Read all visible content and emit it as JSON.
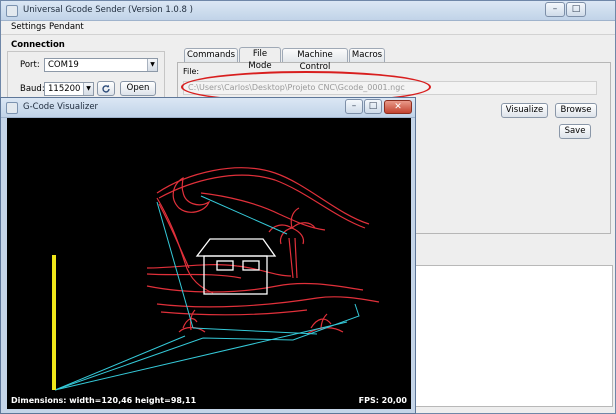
{
  "main_window": {
    "title": "Universal Gcode Sender (Version 1.0.8 )",
    "controls": {
      "minimize": "–",
      "maximize": "□"
    },
    "menu": [
      "Settings",
      "Pendant"
    ],
    "connection": {
      "title": "Connection",
      "port_label": "Port:",
      "port_value": "COM19",
      "baud_label": "Baud:",
      "baud_value": "115200",
      "open_label": "Open",
      "refresh_icon": "refresh-icon"
    },
    "tabs": [
      "Commands",
      "File Mode",
      "Machine Control",
      "Macros"
    ],
    "active_tab": "File Mode",
    "file_label": "File:",
    "file_path": "C:\\Users\\Carlos\\Desktop\\Projeto CNC\\Gcode_0001.ngc",
    "buttons": {
      "visualize": "Visualize",
      "browse": "Browse",
      "save": "Save"
    },
    "highlight_color": "#d81e1e"
  },
  "visualizer": {
    "title": "G-Code Visualizer",
    "dimensions": "Dimensions: width=120,46 height=98,11",
    "fps": "FPS: 20,00",
    "colors": {
      "background": "#000000",
      "toolpath": "#e0303a",
      "rapid": "#35c9d8",
      "current": "#ffffff",
      "z_indicator": "#f0e61a"
    }
  }
}
